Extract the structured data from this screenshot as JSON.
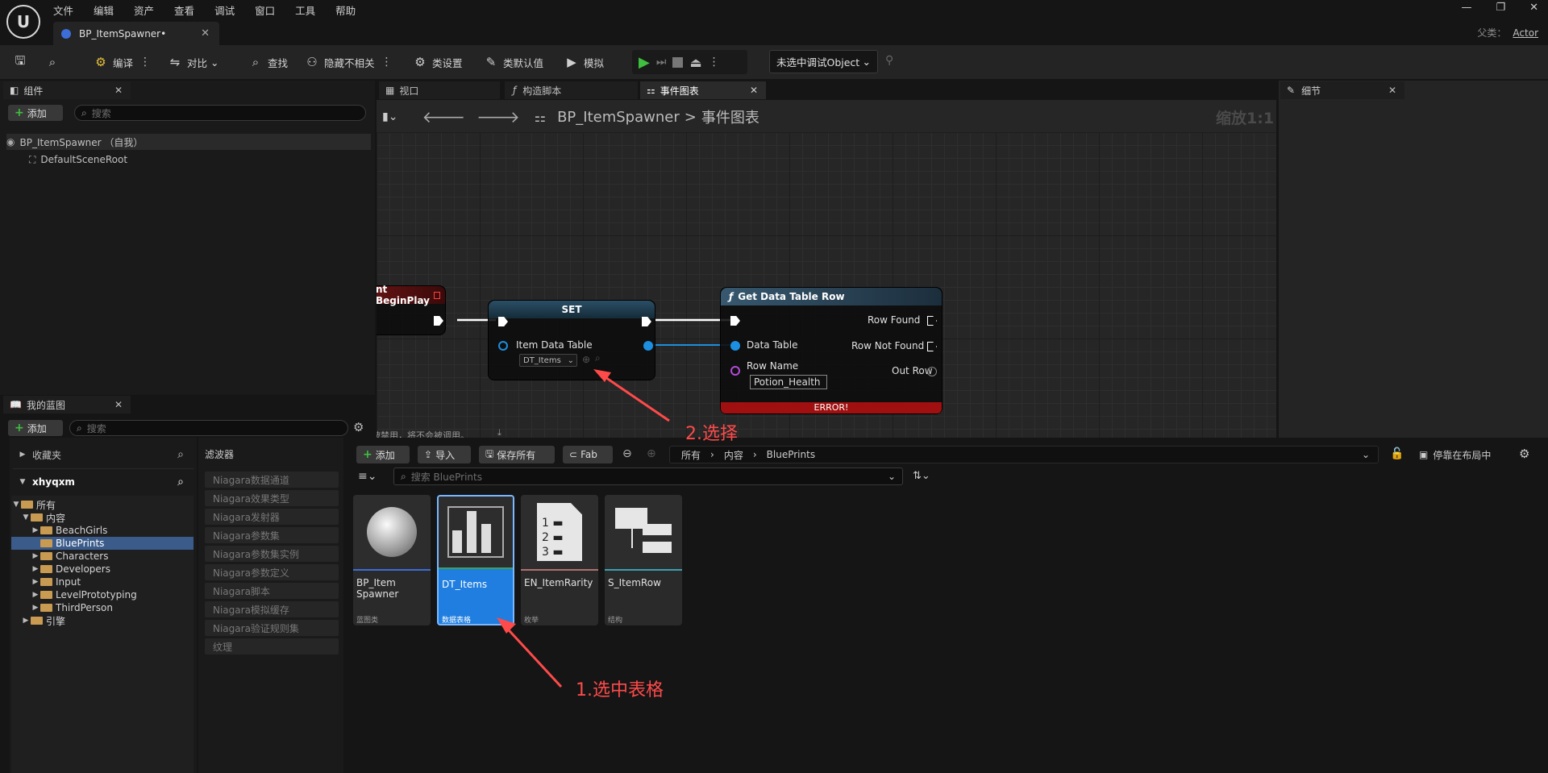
{
  "menu": [
    "文件",
    "编辑",
    "资产",
    "查看",
    "调试",
    "窗口",
    "工具",
    "帮助"
  ],
  "doc_tab": {
    "title": "BP_ItemSpawner•"
  },
  "window": {
    "parent_label": "父类：",
    "parent_value": "Actor"
  },
  "toolbar": {
    "compile": "编译",
    "diff": "对比",
    "find": "查找",
    "hide_unrelated": "隐藏不相关",
    "class_settings": "类设置",
    "class_defaults": "类默认值",
    "simulate": "模拟",
    "debug_object": "未选中调试Object"
  },
  "components": {
    "title": "组件",
    "add": "添加",
    "search_placeholder": "搜索",
    "root": "BP_ItemSpawner （自我）",
    "child": "DefaultSceneRoot"
  },
  "my_blueprint": {
    "title": "我的蓝图",
    "add": "添加",
    "search_placeholder": "搜索"
  },
  "graph_tabs": [
    {
      "label": "视口"
    },
    {
      "label": "构造脚本"
    },
    {
      "label": "事件图表"
    }
  ],
  "graph": {
    "breadcrumb_root": "BP_ItemSpawner",
    "breadcrumb_sep": ">",
    "breadcrumb_current": "事件图表",
    "zoom": "缩放1:1",
    "disabled_note": "被禁用，将不会被调用。",
    "begin_play": {
      "title": "nt BeginPlay"
    },
    "set_node": {
      "title": "SET",
      "pin": "Item Data Table",
      "value": "DT_Items"
    },
    "get_row": {
      "title": "Get Data Table Row",
      "in_data_table": "Data Table",
      "in_row_name": "Row Name",
      "row_name_value": "Potion_Health",
      "out_found": "Row Found",
      "out_not_found": "Row Not Found",
      "out_row": "Out Row",
      "error": "ERROR!"
    }
  },
  "details": {
    "title": "细节"
  },
  "content_browser": {
    "favorites": "收藏夹",
    "project": "xhyqxm",
    "filters_title": "滤波器",
    "add": "添加",
    "import": "导入",
    "save_all": "保存所有",
    "fab": "Fab",
    "path": [
      "所有",
      "内容",
      "BluePrints"
    ],
    "dock": "停靠在布局中",
    "search_placeholder": "搜索 BluePrints",
    "tree": [
      "所有",
      "内容",
      "BeachGirls",
      "BluePrints",
      "Characters",
      "Developers",
      "Input",
      "LevelPrototyping",
      "ThirdPerson",
      "引擎"
    ],
    "filters": [
      "Niagara数据通道",
      "Niagara效果类型",
      "Niagara发射器",
      "Niagara参数集",
      "Niagara参数集实例",
      "Niagara参数定义",
      "Niagara脚本",
      "Niagara模拟缓存",
      "Niagara验证规则集",
      "纹理"
    ],
    "assets": [
      {
        "name": "BP_Item Spawner",
        "type": "蓝图类"
      },
      {
        "name": "DT_Items",
        "type": "数据表格"
      },
      {
        "name": "EN_ItemRarity",
        "type": "枚举"
      },
      {
        "name": "S_ItemRow",
        "type": "结构"
      }
    ]
  },
  "annotations": {
    "step1": "1.选中表格",
    "step2": "2.选择"
  },
  "colors": {
    "accent_selected": "#1f7ee0",
    "exec_green": "#3fbf3f",
    "error_red": "#a01010",
    "annotation_red": "#ff4a4a",
    "data_table_pin": "#1c8fe0",
    "row_name_pin": "#b24cd8"
  }
}
